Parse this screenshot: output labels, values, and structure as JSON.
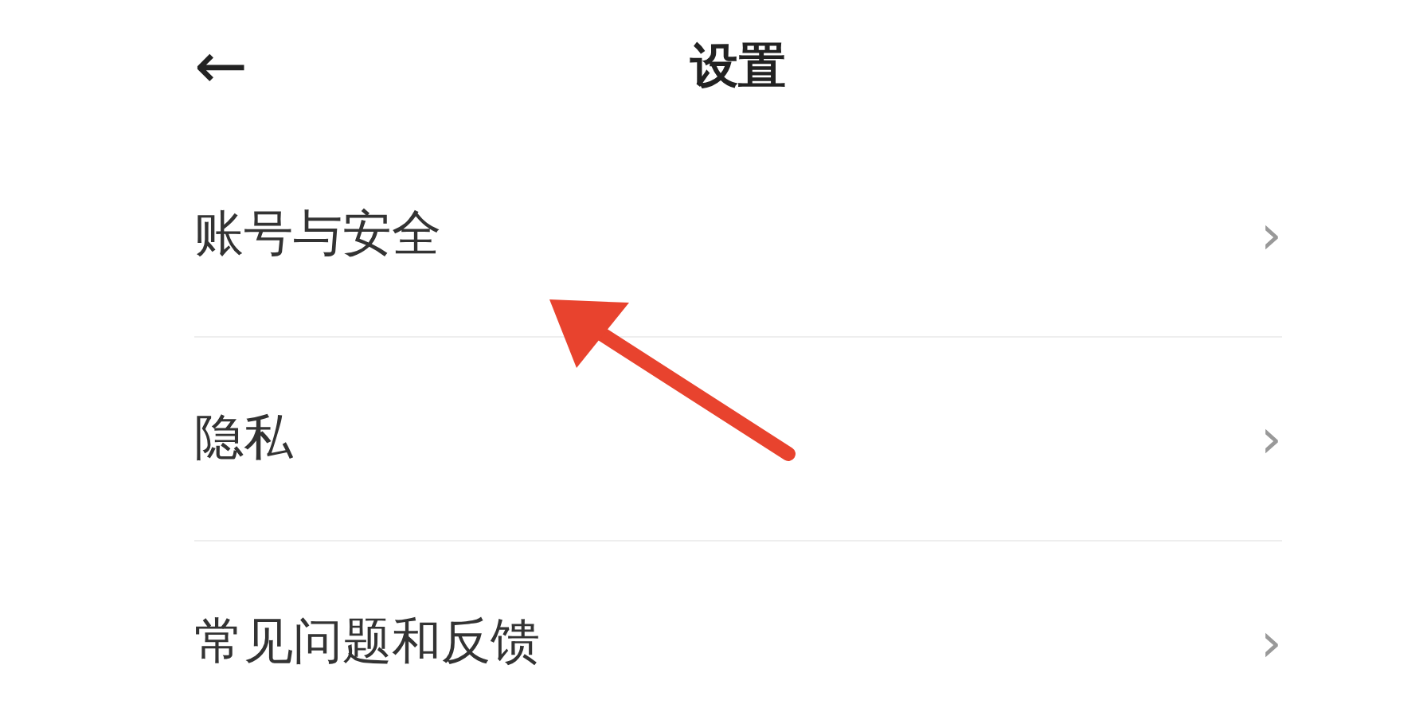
{
  "header": {
    "back": "←",
    "title": "设置"
  },
  "items": [
    {
      "label": "账号与安全",
      "chevron": "›"
    },
    {
      "label": "隐私",
      "chevron": "›"
    },
    {
      "label": "常见问题和反馈",
      "chevron": "›"
    }
  ],
  "annotation": {
    "kind": "arrow"
  }
}
